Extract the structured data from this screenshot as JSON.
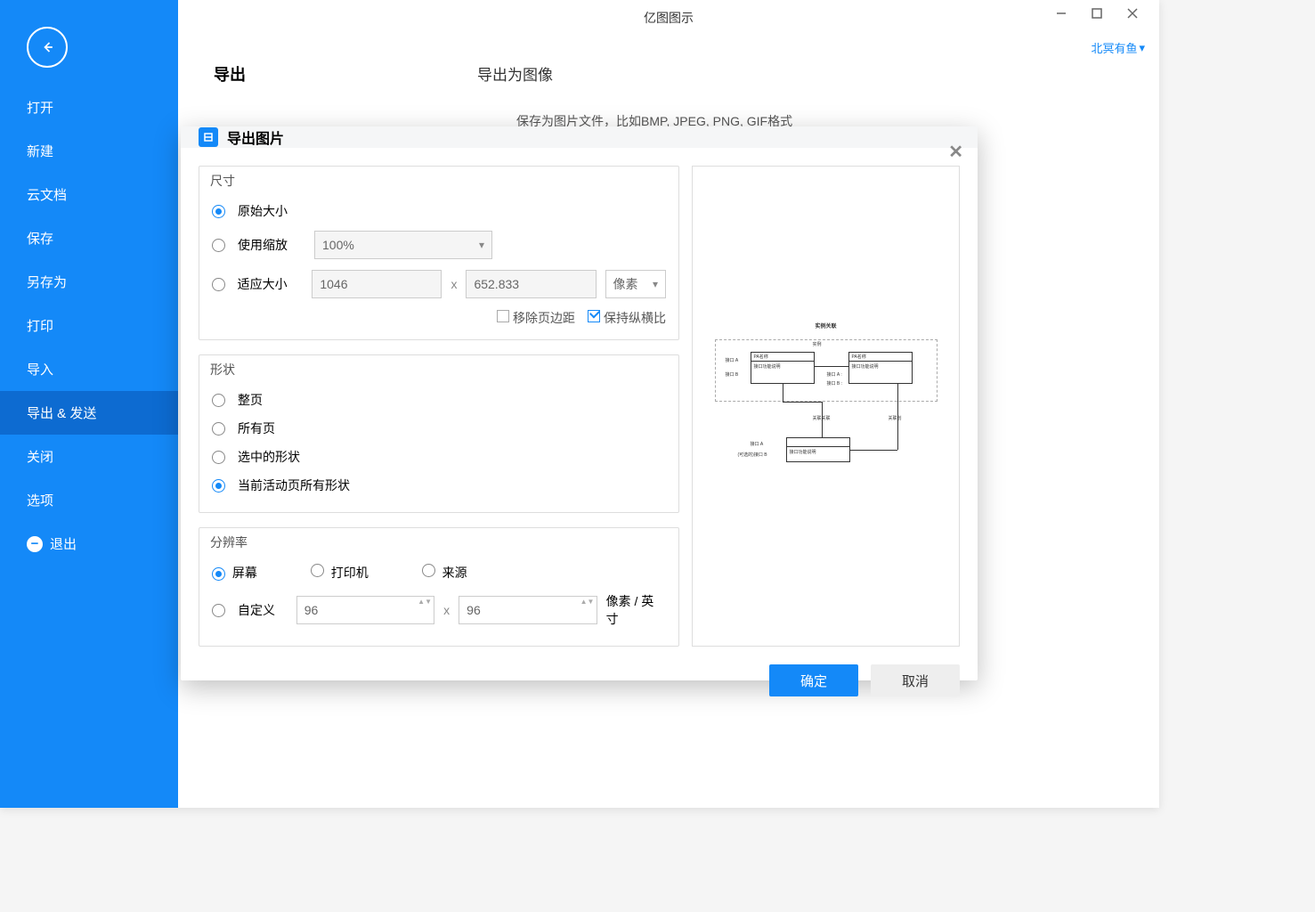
{
  "app": {
    "title": "亿图图示"
  },
  "user": {
    "name": "北冥有鱼"
  },
  "sidebar": {
    "items": [
      "打开",
      "新建",
      "云文档",
      "保存",
      "另存为",
      "打印",
      "导入",
      "导出 & 发送",
      "关闭",
      "选项"
    ],
    "exit": "退出",
    "active_index": 7
  },
  "page": {
    "h1": "导出",
    "h2": "导出为图像",
    "desc": "保存为图片文件，比如BMP, JPEG, PNG, GIF格式"
  },
  "dialog": {
    "title": "导出图片",
    "size": {
      "group": "尺寸",
      "original": "原始大小",
      "use_scale": "使用缩放",
      "scale_val": "100%",
      "fit_size": "适应大小",
      "width": "1046",
      "height": "652.833",
      "unit": "像素",
      "remove_margin": "移除页边距",
      "keep_ratio": "保持纵横比"
    },
    "shape": {
      "group": "形状",
      "whole": "整页",
      "all_pages": "所有页",
      "selected": "选中的形状",
      "current": "当前活动页所有形状"
    },
    "res": {
      "group": "分辨率",
      "screen": "屏幕",
      "printer": "打印机",
      "source": "来源",
      "custom": "自定义",
      "dpi_x": "96",
      "dpi_y": "96",
      "unit": "像素 / 英寸"
    },
    "ok": "确定",
    "cancel": "取消"
  },
  "preview": {
    "title": "实例关联",
    "group": "实例",
    "box1_head": "PA名称",
    "box1_body": "接口功能说明",
    "box2_head": "PA名称",
    "box2_body": "接口功能说明",
    "box3_body": "接口功能说明",
    "rel_left": "关联关联",
    "rel_right": "关联创",
    "port_a": "接口 A",
    "port_b": "接口 B",
    "port_a2": "接口 A :",
    "port_b2": "接口 B :",
    "port_a3": "接口 A",
    "port_b3": "(可选的)接口 B"
  }
}
